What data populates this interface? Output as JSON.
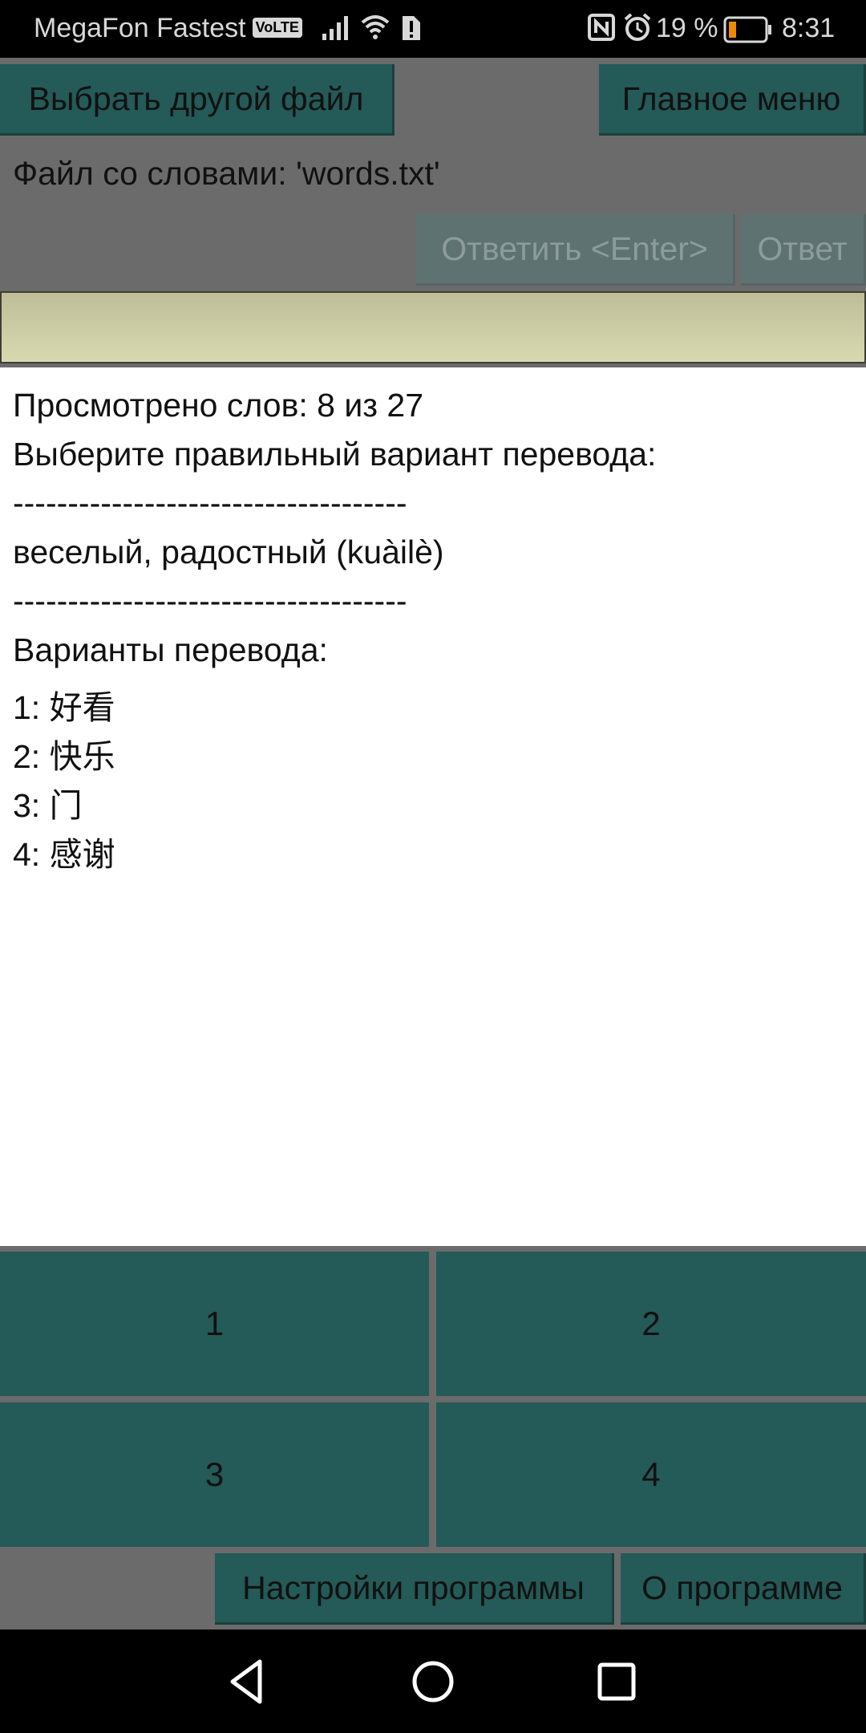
{
  "status_bar": {
    "carrier": "MegaFon Fastest",
    "volte": "VoLTE",
    "battery_percent": "19 %",
    "time": "8:31",
    "icons": [
      "signal-icon",
      "wifi-icon",
      "sim-alert-icon",
      "nfc-icon",
      "alarm-icon",
      "battery-icon"
    ]
  },
  "toolbar": {
    "choose_file_label": "Выбрать другой файл",
    "main_menu_label": "Главное меню",
    "file_label": "Файл со словами: 'words.txt'",
    "answer_enter_label": "Ответить <Enter>",
    "answer_label": "Ответ"
  },
  "answer_field": {
    "value": "",
    "placeholder": ""
  },
  "content": {
    "progress": "Просмотрено слов: 8 из 27",
    "instruction": "Выберите правильный вариант перевода:",
    "separator_top": "------------------------------------",
    "word": "веселый, радостный (kuàilè)",
    "separator_bottom": "------------------------------------",
    "options_heading": "Варианты перевода:",
    "options": [
      "1: 好看",
      "2: 快乐",
      "3: 门",
      "4: 感谢"
    ]
  },
  "option_buttons": [
    "1",
    "2",
    "3",
    "4"
  ],
  "bottom_bar": {
    "settings_label": "Настройки программы",
    "about_label": "О программе"
  },
  "nav": {
    "icons": [
      "back-icon",
      "home-icon",
      "recents-icon"
    ]
  },
  "colors": {
    "background": "#6b6b6b",
    "button": "#245a57",
    "button_disabled": "#5f7272",
    "input": "#d9d9b1"
  }
}
